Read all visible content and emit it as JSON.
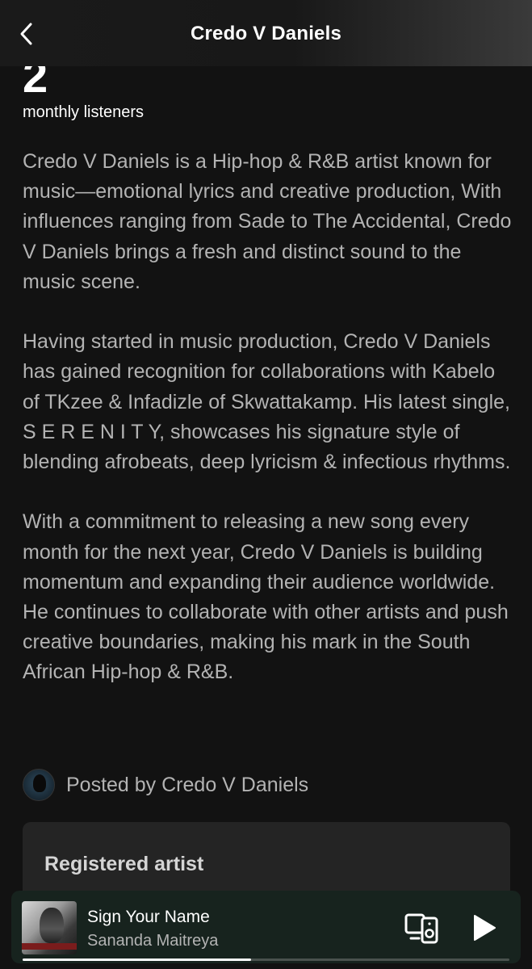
{
  "header": {
    "title": "Credo V Daniels",
    "back_icon": "chevron-left-icon"
  },
  "stats": {
    "listeners_count": "2",
    "listeners_label": "monthly listeners"
  },
  "bio": {
    "paragraphs": [
      "Credo V Daniels is a Hip-hop & R&B artist known for music—emotional lyrics and creative production, With influences ranging from Sade to The Accidental, Credo V Daniels brings a fresh and distinct sound to the music scene.",
      "Having started in music production, Credo V Daniels has gained recognition for collaborations with Kabelo of TKzee & Infadizle of Skwattakamp. His latest single, S E R E N I T Y, showcases his signature style of blending afrobeats, deep lyricism & infectious rhythms.",
      "With a commitment to releasing a new song every month for the next year, Credo V Daniels is building momentum and expanding their audience worldwide. He continues to collaborate with other artists and push creative boundaries, making his mark in the South African Hip-hop & R&B."
    ]
  },
  "posted_by": {
    "text": "Posted by Credo V Daniels"
  },
  "registered": {
    "label": "Registered artist"
  },
  "player": {
    "track_title": "Sign Your Name",
    "track_artist": "Sananda Maitreya",
    "progress": 0.47,
    "device_icon": "connect-device-icon",
    "play_icon": "play-icon"
  },
  "colors": {
    "background": "#121212",
    "secondary_text": "#b3b3b3",
    "card": "#242424",
    "player_bg": "#17231e"
  }
}
